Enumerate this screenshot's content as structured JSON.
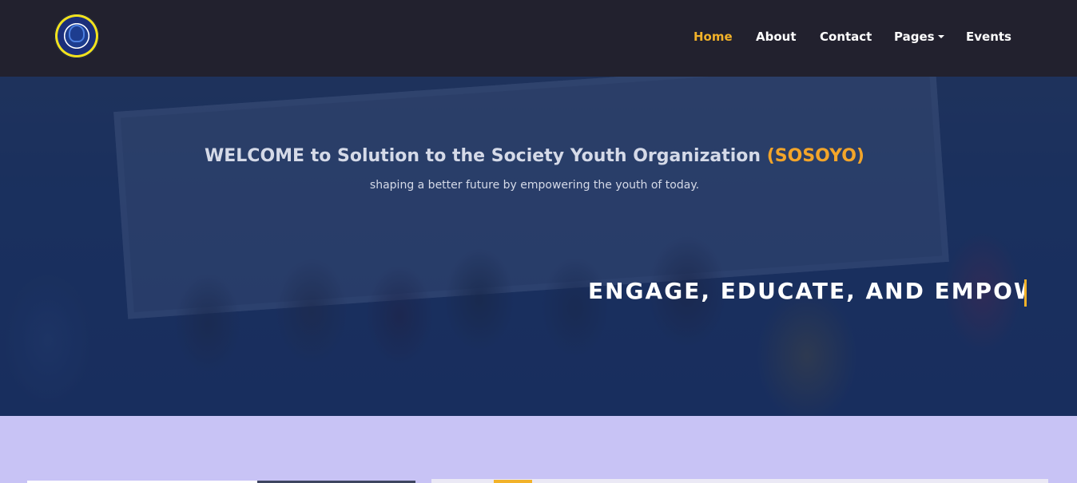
{
  "nav": {
    "items": [
      {
        "label": "Home",
        "active": true
      },
      {
        "label": "About",
        "active": false
      },
      {
        "label": "Contact",
        "active": false
      },
      {
        "label": "Pages",
        "active": false,
        "dropdown": true
      },
      {
        "label": "Events",
        "active": false
      }
    ]
  },
  "hero": {
    "title_prefix": "WELCOME to Solution to the Society Youth Organization ",
    "title_accent": "(SOSOYO)",
    "subtitle": "shaping a better future by empowering the youth of today.",
    "typing_text": "ENGAGE, EDUCATE, AND EMPOWE"
  },
  "colors": {
    "navbar_bg": "#22212e",
    "active_link": "#f2b229",
    "accent": "#f3a52a",
    "hero_overlay": "#1c3160",
    "section_bg": "#c8c3f5"
  },
  "icons": {
    "logo": "organization-logo",
    "pages_dropdown": "caret-down-icon"
  }
}
